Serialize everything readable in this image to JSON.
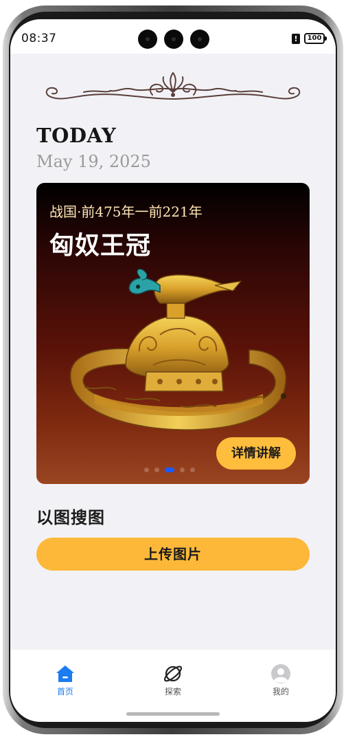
{
  "status_bar": {
    "time": "08:37",
    "battery": "100",
    "alert_glyph": "!"
  },
  "today": {
    "title": "TODAY",
    "date": "May 19, 2025"
  },
  "hero": {
    "subtitle": "战国·前475年一前221年",
    "title": "匈奴王冠",
    "detail_button": "详情讲解",
    "pager": {
      "count": 5,
      "active_index": 2
    }
  },
  "image_search": {
    "title": "以图搜图",
    "upload_button": "上传图片"
  },
  "tab_bar": {
    "tabs": [
      {
        "label": "首页",
        "icon": "home-icon",
        "active": true
      },
      {
        "label": "探索",
        "icon": "explore-icon",
        "active": false
      },
      {
        "label": "我的",
        "icon": "profile-icon",
        "active": false
      }
    ]
  },
  "colors": {
    "accent_yellow": "#fdb83a",
    "active_tab_blue": "#1a7cf0",
    "pager_active": "#1a5bff",
    "background": "#f2f2f6"
  }
}
